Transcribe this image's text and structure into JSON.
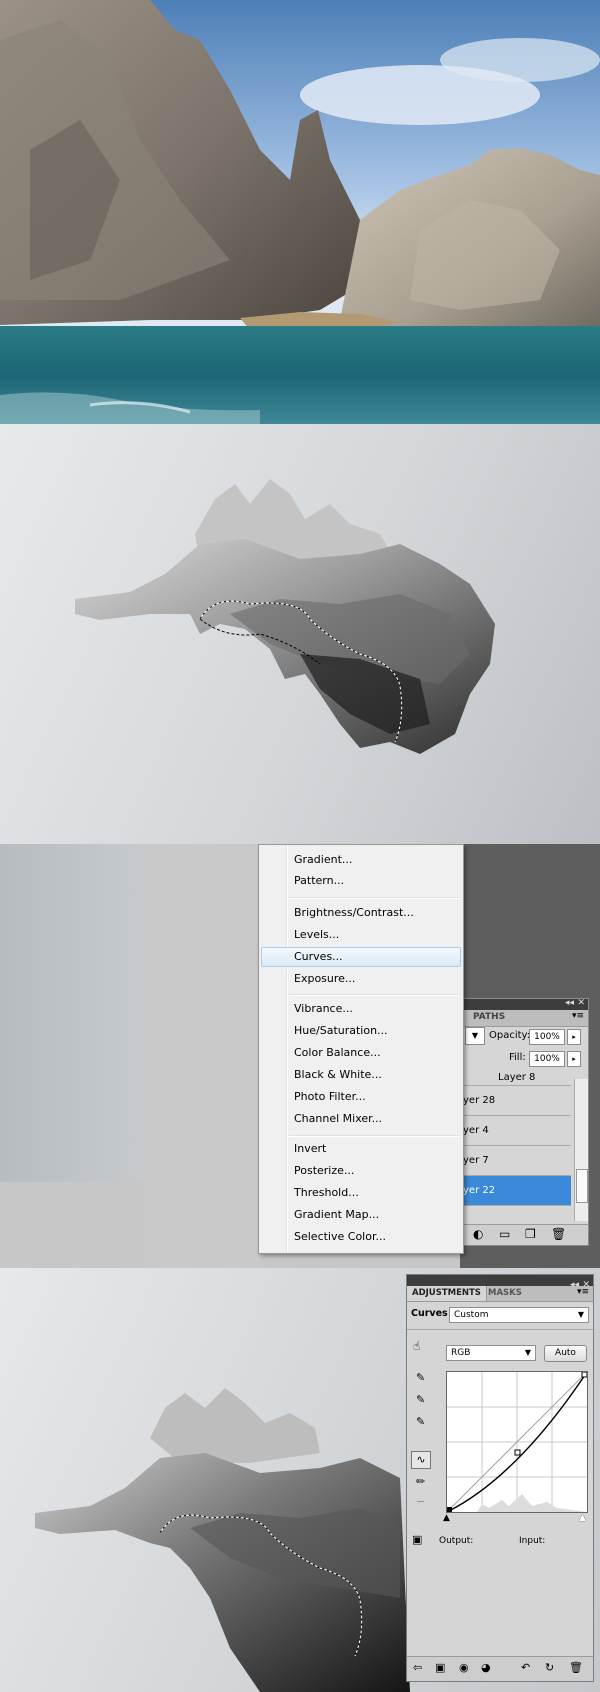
{
  "context_menu": {
    "items": [
      "Gradient...",
      "Pattern...",
      "Brightness/Contrast...",
      "Levels...",
      "Curves...",
      "Exposure...",
      "Vibrance...",
      "Hue/Saturation...",
      "Color Balance...",
      "Black & White...",
      "Photo Filter...",
      "Channel Mixer...",
      "Invert",
      "Posterize...",
      "Threshold...",
      "Gradient Map...",
      "Selective Color..."
    ],
    "highlighted": "Curves..."
  },
  "layers_panel": {
    "tab_label": "PATHS",
    "opacity_label": "Opacity:",
    "opacity_value": "100%",
    "fill_label": "Fill:",
    "fill_value": "100%",
    "layers": [
      "Layer 8",
      "yer 28",
      "yer 4",
      "yer 7",
      "yer 22"
    ],
    "selected_layer": "yer 22"
  },
  "adjustments_panel": {
    "tabs": [
      "ADJUSTMENTS",
      "MASKS"
    ],
    "adjustment_type": "Curves",
    "preset_value": "Custom",
    "channel_value": "RGB",
    "auto_label": "Auto",
    "output_label": "Output:",
    "input_label": "Input:"
  },
  "colors": {
    "menu_highlight": "#dceaf6",
    "layer_selected": "#3b8ad9",
    "sky": "#4d7fb8",
    "water": "#1f6f82"
  }
}
